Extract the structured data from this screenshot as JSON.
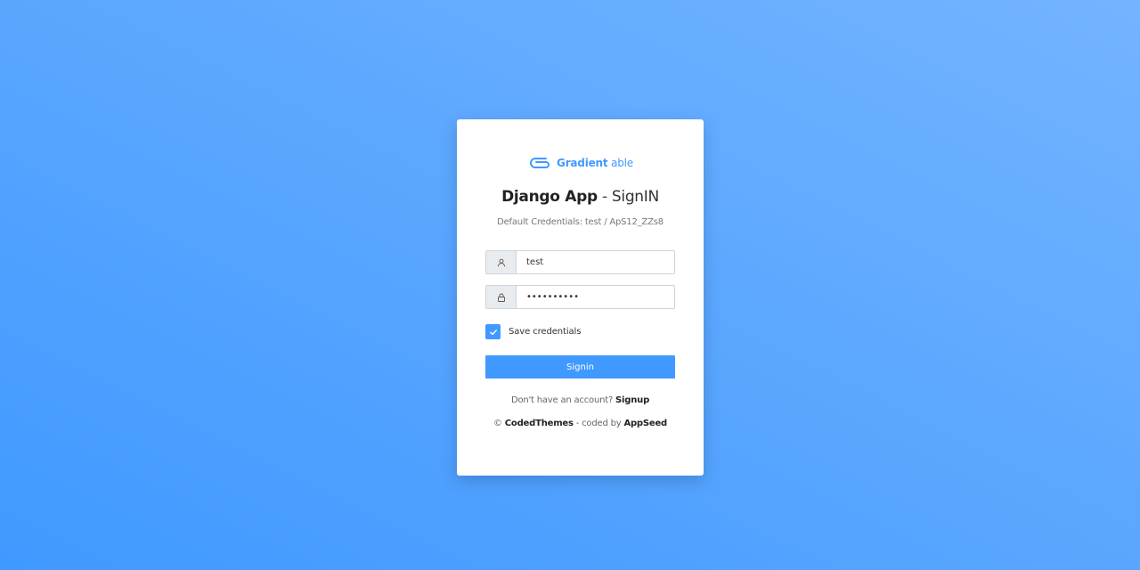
{
  "logo": {
    "text_bold": "Gradient",
    "text_light": "able",
    "icon": "paperclip-logo-icon",
    "color": "#4099ff"
  },
  "title": {
    "app": "Django App",
    "separator": " - ",
    "action": "SignIN"
  },
  "credentials_hint": "Default Credentials: test / ApS12_ZZs8",
  "username": {
    "icon": "user-icon",
    "value": "test"
  },
  "password": {
    "icon": "lock-icon",
    "value": "ApS12_ZZs8"
  },
  "remember": {
    "checked": true,
    "label": "Save credentials"
  },
  "submit": {
    "label": "Signin"
  },
  "signup": {
    "prompt": "Don't have an account?",
    "link_label": "Signup"
  },
  "footer": {
    "copyright": "©",
    "brand": "CodedThemes",
    "middle": "- coded by",
    "author": "AppSeed"
  },
  "colors": {
    "accent": "#4099ff",
    "background_from": "#4099ff",
    "background_to": "#73b4ff"
  }
}
